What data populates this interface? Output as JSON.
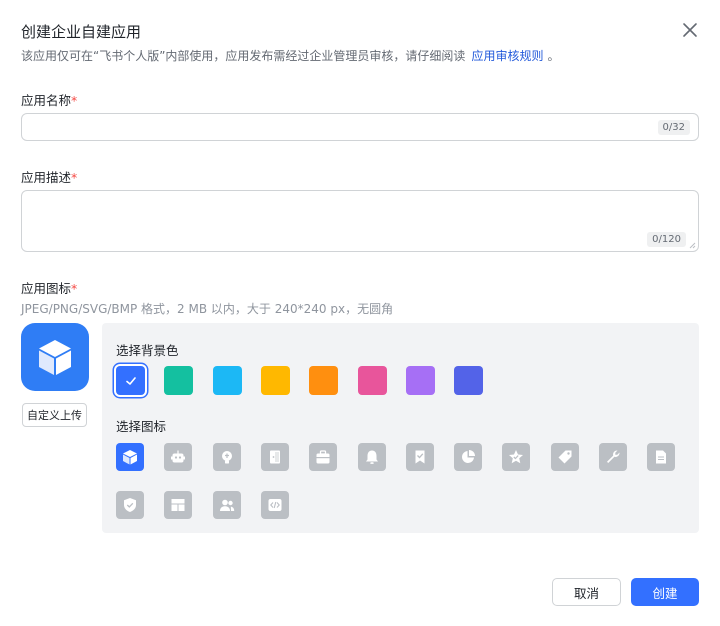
{
  "dialog": {
    "title": "创建企业自建应用",
    "subtitle": "该应用仅可在“飞书个人版”内部使用，应用发布需经过企业管理员审核，请仔细阅读",
    "rules_link": "应用审核规则",
    "subtitle_end": "。",
    "close_icon": "close-icon"
  },
  "form": {
    "name_label": "应用名称",
    "name_value": "",
    "name_counter": "0/32",
    "desc_label": "应用描述",
    "desc_value": "",
    "desc_counter": "0/120",
    "icon_label": "应用图标",
    "required_mark": "*",
    "icon_hint": "JPEG/PNG/SVG/BMP 格式，2 MB 以内，大于 240*240 px，无圆角",
    "upload_label": "自定义上传"
  },
  "icon_picker": {
    "bg_label": "选择背景色",
    "icon_label": "选择图标",
    "colors": [
      "#3370ff",
      "#14c0a0",
      "#1cb8f5",
      "#ffb800",
      "#ff8f0f",
      "#e8559b",
      "#a66ff5",
      "#5363e8"
    ],
    "selected_color_index": 0,
    "icons": [
      "cube-icon",
      "robot-icon",
      "bulb-icon",
      "door-icon",
      "toolbox-icon",
      "bell-icon",
      "bookmark-icon",
      "pie-chart-icon",
      "star-icon",
      "tag-icon",
      "wrench-icon",
      "document-icon",
      "shield-check-icon",
      "layout-icon",
      "users-icon",
      "code-icon"
    ],
    "selected_icon_index": 0
  },
  "footer": {
    "cancel_label": "取消",
    "create_label": "创建"
  }
}
